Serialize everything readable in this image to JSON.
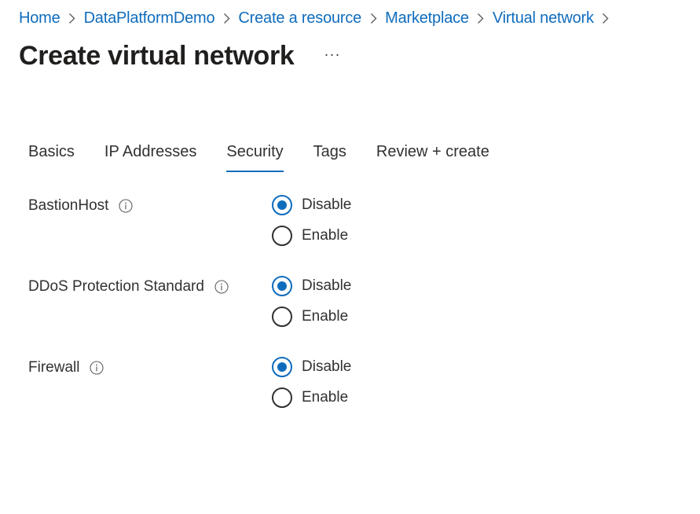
{
  "breadcrumb": {
    "items": [
      "Home",
      "DataPlatformDemo",
      "Create a resource",
      "Marketplace",
      "Virtual network"
    ]
  },
  "header": {
    "title": "Create virtual network",
    "more_label": "···"
  },
  "tabs": [
    {
      "label": "Basics",
      "active": false
    },
    {
      "label": "IP Addresses",
      "active": false
    },
    {
      "label": "Security",
      "active": true
    },
    {
      "label": "Tags",
      "active": false
    },
    {
      "label": "Review + create",
      "active": false
    }
  ],
  "fields": [
    {
      "label": "BastionHost",
      "options": [
        {
          "label": "Disable",
          "selected": true
        },
        {
          "label": "Enable",
          "selected": false
        }
      ]
    },
    {
      "label": "DDoS Protection Standard",
      "options": [
        {
          "label": "Disable",
          "selected": true
        },
        {
          "label": "Enable",
          "selected": false
        }
      ]
    },
    {
      "label": "Firewall",
      "options": [
        {
          "label": "Disable",
          "selected": true
        },
        {
          "label": "Enable",
          "selected": false
        }
      ]
    }
  ],
  "icons": {
    "breadcrumb_separator": "chevron-right-icon",
    "info": "info-icon"
  },
  "colors": {
    "accent": "#0f6cbd",
    "text": "#323130",
    "title": "#201f1e"
  }
}
